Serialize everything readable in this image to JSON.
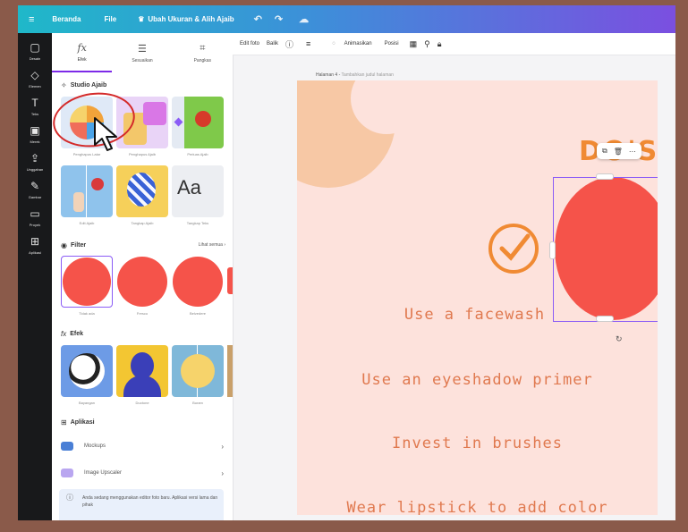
{
  "topbar": {
    "menu_icon": "hamburger-icon",
    "home": "Beranda",
    "file": "File",
    "resize": "Ubah Ukuran & Alih Ajaib",
    "undo_icon": "undo-icon",
    "redo_icon": "redo-icon",
    "cloud_icon": "cloud-save-icon"
  },
  "leftnav": {
    "items": [
      {
        "label": "Desain",
        "icon": "layout-icon"
      },
      {
        "label": "Elemen",
        "icon": "shapes-icon"
      },
      {
        "label": "Teks",
        "icon": "text-icon"
      },
      {
        "label": "Merek",
        "icon": "brand-icon"
      },
      {
        "label": "Unggahan",
        "icon": "upload-icon"
      },
      {
        "label": "Gambar",
        "icon": "draw-icon"
      },
      {
        "label": "Proyek",
        "icon": "folder-icon"
      },
      {
        "label": "Aplikasi",
        "icon": "apps-icon"
      }
    ]
  },
  "panel": {
    "tabs": [
      {
        "label": "Efek",
        "icon": "fx-icon"
      },
      {
        "label": "Sesuaikan",
        "icon": "adjust-icon"
      },
      {
        "label": "Pangkas",
        "icon": "crop-icon"
      }
    ],
    "studio_title": "Studio Ajaib",
    "studio_items": [
      "Penghapus Latar",
      "Penghapus Ajaib",
      "Perluas Ajaib",
      "Edit Ajaib",
      "Tangkap Ajaib",
      "Tangkap Teks"
    ],
    "filter_title": "Filter",
    "see_all": "Lihat semua",
    "filters": [
      "Tidak ada",
      "Fresco",
      "Belvedere"
    ],
    "effects_title": "Efek",
    "effects": [
      "Bayangan",
      "Duotone",
      "Buram"
    ],
    "apps_title": "Aplikasi",
    "apps": [
      "Mockups",
      "Image Upscaler"
    ],
    "notice": "Anda sedang menggunakan editor foto baru. Aplikasi versi lama dan pihak"
  },
  "toolbar": {
    "edit_photo": "Edit foto",
    "flip": "Balik",
    "info_icon": "info-icon",
    "lines_icon": "lines-icon",
    "animate": "Animasikan",
    "position": "Posisi",
    "transparency_icon": "transparency-icon",
    "paint_icon": "paint-roller-icon",
    "lock_icon": "lock-icon"
  },
  "canvas": {
    "page_label": "Halaman 4 -",
    "page_title_placeholder": "Tambahkan judul halaman",
    "heading_partial": "DO'S",
    "items": [
      "Use a facewash",
      "Use an eyeshadow primer",
      "Invest in brushes",
      "Wear lipstick to add color"
    ],
    "float_icons": [
      "copy-icon",
      "trash-icon",
      "more-icon"
    ],
    "rotate_icon": "rotate-icon"
  },
  "colors": {
    "accent": "#7d2ae8",
    "canvas_bg": "#fde2dc",
    "text_orange": "#e0794f",
    "red_circle": "#f5534a",
    "annotation": "#d42a2a"
  }
}
